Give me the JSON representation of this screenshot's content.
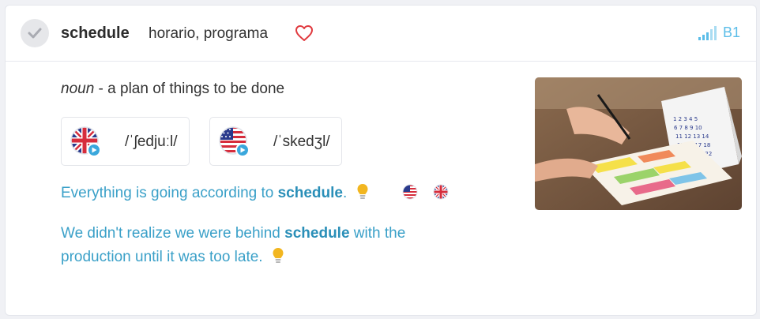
{
  "header": {
    "word": "schedule",
    "translation": "horario, programa",
    "level": "B1"
  },
  "definition": {
    "part_of_speech": "noun",
    "text": " - a plan of things to be done"
  },
  "pronunciations": [
    {
      "flag": "uk-flag-icon",
      "ipa": "/ˈʃedjuːl/"
    },
    {
      "flag": "us-flag-icon",
      "ipa": "/ˈskedʒl/"
    }
  ],
  "examples": [
    {
      "before": "Everything is going according to ",
      "keyword": "schedule",
      "after": "."
    },
    {
      "before": "We didn't realize we were behind ",
      "keyword": "schedule",
      "after": " with the"
    },
    {
      "line2": "production until it was too late."
    }
  ],
  "colors": {
    "example_text": "#3aa0c8",
    "level": "#5bbde8",
    "heart": "#e0393e",
    "bulb": "#f2b620"
  }
}
